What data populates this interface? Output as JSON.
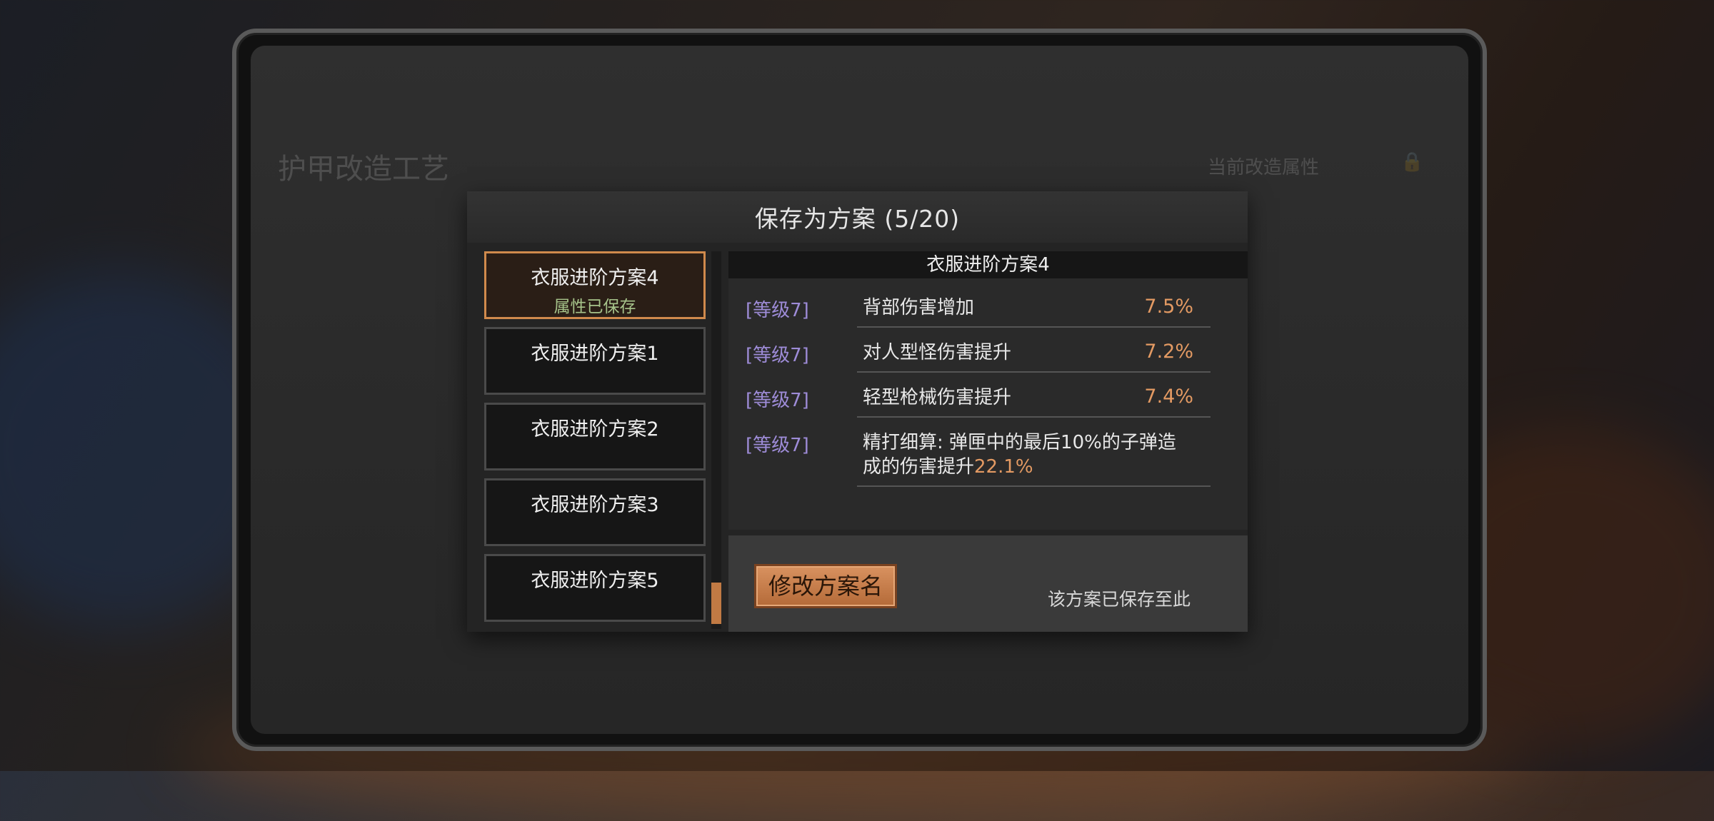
{
  "modal": {
    "title": "保存为方案 (5/20)",
    "rename_label": "修改方案名",
    "saved_note": "该方案已保存至此"
  },
  "plans": [
    {
      "name": "衣服进阶方案4",
      "status": "属性已保存",
      "selected": true
    },
    {
      "name": "衣服进阶方案1",
      "status": "",
      "selected": false
    },
    {
      "name": "衣服进阶方案2",
      "status": "",
      "selected": false
    },
    {
      "name": "衣服进阶方案3",
      "status": "",
      "selected": false
    },
    {
      "name": "衣服进阶方案5",
      "status": "",
      "selected": false
    }
  ],
  "detail": {
    "title": "衣服进阶方案4",
    "rows": [
      {
        "level": "[等级7]",
        "name": "背部伤害增加",
        "value": "7.5%"
      },
      {
        "level": "[等级7]",
        "name": "对人型怪伤害提升",
        "value": "7.2%"
      },
      {
        "level": "[等级7]",
        "name": "轻型枪械伤害提升",
        "value": "7.4%"
      },
      {
        "level": "[等级7]",
        "name_line1": "精打细算: 弹匣中的最后10%的子弹造",
        "name_line2": "成的伤害提升",
        "name_highlight": "22.1%"
      }
    ]
  },
  "background": {
    "title": "护甲改造工艺",
    "right_header": "当前改造属性"
  },
  "colors": {
    "accent": "#d08a4c",
    "level_text": "#9e8cd8",
    "value_text": "#e39a63",
    "saved_status": "#a6c38a"
  }
}
